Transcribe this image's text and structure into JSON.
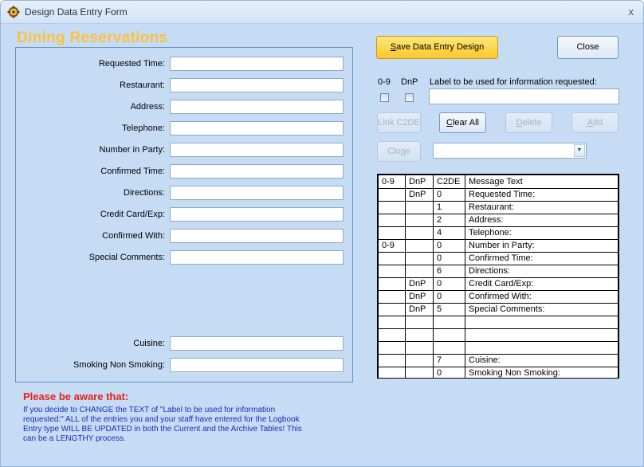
{
  "window": {
    "title": "Design Data Entry Form",
    "close_glyph": "x",
    "icon": "gear-app-icon"
  },
  "form": {
    "title": "Dining Reservations",
    "fields": [
      {
        "label": "Requested Time:",
        "value": ""
      },
      {
        "label": "Restaurant:",
        "value": ""
      },
      {
        "label": "Address:",
        "value": ""
      },
      {
        "label": "Telephone:",
        "value": ""
      },
      {
        "label": "Number in Party:",
        "value": ""
      },
      {
        "label": "Confirmed Time:",
        "value": ""
      },
      {
        "label": "Directions:",
        "value": ""
      },
      {
        "label": "Credit Card/Exp:",
        "value": ""
      },
      {
        "label": "Confirmed With:",
        "value": ""
      },
      {
        "label": "Special Comments:",
        "value": ""
      },
      {
        "label": "Cuisine:",
        "value": ""
      },
      {
        "label": "Smoking Non Smoking:",
        "value": ""
      }
    ]
  },
  "toolbar": {
    "save_pre": "",
    "save_key": "S",
    "save_post": "ave Data Entry Design",
    "close_label": "Close",
    "link_label": "Link C2DE",
    "clear_pre": "",
    "clear_key": "C",
    "clear_post": "lear All",
    "delete_pre": "",
    "delete_key": "D",
    "delete_post": "elete",
    "add_pre": "",
    "add_key": "A",
    "add_post": "dd",
    "clone_pre": "Clo",
    "clone_key": "n",
    "clone_post": "e"
  },
  "options": {
    "digits_label": "0-9",
    "dnp_label": "DnP",
    "info_label": "Label to be used for information requested:",
    "info_value": "",
    "combo_value": ""
  },
  "grid": {
    "headers": [
      "0-9",
      "DnP",
      "C2DE",
      "Message Text"
    ],
    "rows": [
      [
        "",
        "DnP",
        "0",
        "Requested Time:"
      ],
      [
        "",
        "",
        "1",
        "Restaurant:"
      ],
      [
        "",
        "",
        "2",
        "Address:"
      ],
      [
        "",
        "",
        "4",
        "Telephone:"
      ],
      [
        "0-9",
        "",
        "0",
        "Number in Party:"
      ],
      [
        "",
        "",
        "0",
        "Confirmed Time:"
      ],
      [
        "",
        "",
        "6",
        "Directions:"
      ],
      [
        "",
        "DnP",
        "0",
        "Credit Card/Exp:"
      ],
      [
        "",
        "DnP",
        "0",
        "Confirmed With:"
      ],
      [
        "",
        "DnP",
        "5",
        "Special Comments:"
      ],
      [
        "",
        "",
        "",
        ""
      ],
      [
        "",
        "",
        "",
        ""
      ],
      [
        "",
        "",
        "",
        ""
      ],
      [
        "",
        "",
        "7",
        "Cuisine:"
      ],
      [
        "",
        "",
        "0",
        "Smoking Non Smoking:"
      ]
    ]
  },
  "warning": {
    "title": "Please be aware that:",
    "text": "If you decide to CHANGE the TEXT of \"Label to be used for information requested:\"     ALL of the entries you and your staff have entered for the Logbook Entry type WILL BE UPDATED in both the Current and the Archive Tables!  This can be a LENGTHY process."
  }
}
